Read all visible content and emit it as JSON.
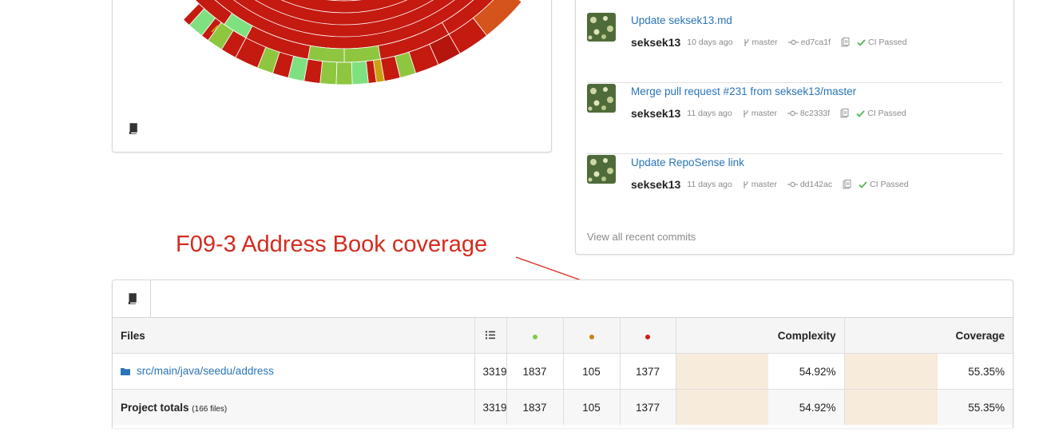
{
  "commits": {
    "items": [
      {
        "message": "Update seksek13.md",
        "author": "seksek13",
        "time": "10 days ago",
        "branch": "master",
        "hash": "ed7ca1f",
        "ci": "CI Passed"
      },
      {
        "message": "Merge pull request #231 from seksek13/master",
        "author": "seksek13",
        "time": "11 days ago",
        "branch": "master",
        "hash": "8c2333f",
        "ci": "CI Passed"
      },
      {
        "message": "Update RepoSense link",
        "author": "seksek13",
        "time": "11 days ago",
        "branch": "master",
        "hash": "dd142ac",
        "ci": "CI Passed"
      }
    ],
    "view_all": "View all recent commits"
  },
  "annotation": {
    "text": "F09-3 Address Book coverage",
    "color": "#d52b1e"
  },
  "files_table": {
    "headers": {
      "files": "Files",
      "complexity": "Complexity",
      "coverage": "Coverage"
    },
    "header_icons": [
      "lines-icon",
      "green-dot-icon",
      "orange-dot-icon",
      "red-dot-icon"
    ],
    "colors": {
      "hit": "#7ccd4a",
      "partial": "#c8820c",
      "miss": "#d01c14",
      "link": "#2a74b7"
    },
    "rows": [
      {
        "name": "src/main/java/seedu/address",
        "lines": "3319",
        "hits": "1837",
        "partials": "105",
        "misses": "1377",
        "complexity": "54.92%",
        "coverage": "55.35%",
        "complexity_ratio": 0.5492,
        "coverage_ratio": 0.5535
      }
    ],
    "totals": {
      "label": "Project totals",
      "sub": "(166 files)",
      "lines": "3319",
      "hits": "1837",
      "partials": "105",
      "misses": "1377",
      "complexity": "54.92%",
      "coverage": "55.35%",
      "complexity_ratio": 0.5492,
      "coverage_ratio": 0.5535
    }
  }
}
